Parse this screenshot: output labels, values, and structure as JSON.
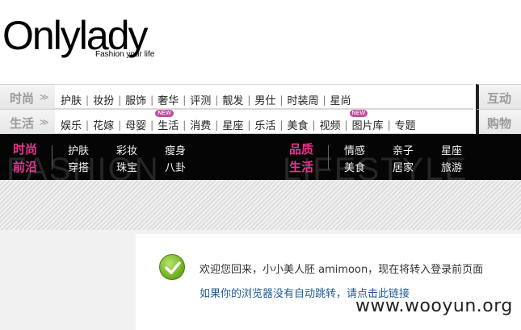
{
  "logo": {
    "text": "Onlylady",
    "tagline": "Fashion your life"
  },
  "nav": {
    "row1": {
      "label": "时尚",
      "arrow": "≫",
      "items": [
        "护肤",
        "妆扮",
        "服饰",
        "奢华",
        "评测",
        "靓发",
        "男仕",
        "时装周",
        "星尚"
      ],
      "side_tab": "互动"
    },
    "row2": {
      "label": "生活",
      "arrow": "≫",
      "items": [
        "娱乐",
        "花嫁",
        "母婴",
        "生活",
        "消费",
        "星座",
        "乐活",
        "美食",
        "视频",
        "图片库",
        "专题"
      ],
      "badge": "NEW",
      "side_tab": "购物"
    },
    "separator": "|"
  },
  "band": {
    "left": {
      "category_line1": "时尚",
      "category_line2": "前沿",
      "ghost": "FASHION",
      "row1": [
        "护肤",
        "彩妆",
        "瘦身"
      ],
      "row2": [
        "穿搭",
        "珠宝",
        "八卦"
      ]
    },
    "right": {
      "category_line1": "品质",
      "category_line2": "生活",
      "ghost": "LIFESTYLE",
      "row1": [
        "情感",
        "亲子",
        "星座"
      ],
      "row2": [
        "美食",
        "居家",
        "旅游"
      ]
    }
  },
  "message": {
    "welcome": "欢迎您回来，小小美人胚 amimoon，现在将转入登录前页面",
    "link": "如果你的浏览器没有自动跳转，请点击此链接"
  },
  "watermark": "www.wooyun.org",
  "colors": {
    "accent_pink": "#e8358f",
    "link_blue": "#1f5a93",
    "success_green": "#6aab1a"
  }
}
